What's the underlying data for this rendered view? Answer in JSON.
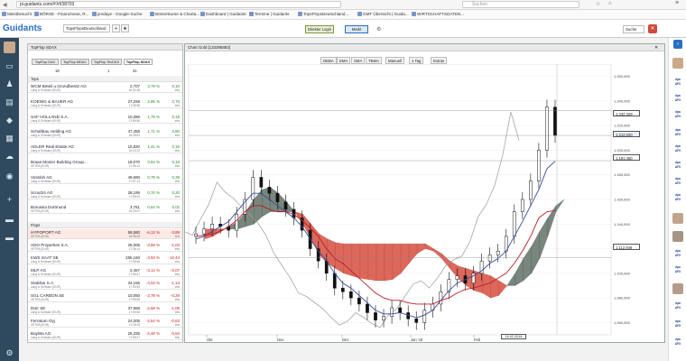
{
  "browser": {
    "url": "pi.guidants.com/#!/rf/38703",
    "search_placeholder": "Suchen"
  },
  "bookmarks": [
    "Meistbesucht",
    "BÖRSE - Finanznews, R...",
    "jendaye - Google-Suche",
    "Börsenkurse & Charta...",
    "Dashboard | Guidants",
    "Termine | Guidants",
    "TopsFlopsDeutschland...",
    "GMT Übersicht | Guida...",
    "WIRTSCHAFTSDATEN..."
  ],
  "header": {
    "logo": "Guidants",
    "layout_label": "TopsFlopsDeutschland",
    "demo_button": "Direkter Login",
    "market_button": "Markt",
    "search_label": "Suche"
  },
  "watchlist": {
    "title": "TopFlop SDAX",
    "tabs": [
      "TopFlop DAX",
      "TopFlop MDAX",
      "TopFlop TecDAX",
      "TopFlop SDAX"
    ],
    "counts": [
      "18",
      "1",
      "31"
    ],
    "tops_header": "Tops",
    "flops_header": "Flops",
    "tops": [
      {
        "name": "WCM Beteil.u.Grundbesitz AG",
        "exchange": "Lang & Schwarz (EUR)",
        "price": "2,707",
        "time": "16:32:28",
        "pct": "3,79 %",
        "abs": "0,10",
        "exch_short": "ebs"
      },
      {
        "name": "KOENIG & BAUER AG",
        "exchange": "Lang & Schwarz (EUR)",
        "price": "27,258",
        "time": "17:59:56",
        "pct": "2,85 %",
        "abs": "0,76",
        "exch_short": "ebs"
      },
      {
        "name": "SAF HOLLAND S.A.",
        "exchange": "Lang & Schwarz (EUR)",
        "price": "10,086",
        "time": "17:59:56",
        "pct": "1,79 %",
        "abs": "0,18",
        "exch_short": "ebs"
      },
      {
        "name": "Schaltbau Holding AG",
        "exchange": "Lang & Schwarz (EUR)",
        "price": "47,458",
        "time": "16:28:51",
        "pct": "1,71 %",
        "abs": "0,80",
        "exch_short": "ebs"
      },
      {
        "name": "ADLER Real Estate AG",
        "exchange": "Lang & Schwarz (EUR)",
        "price": "10,820",
        "time": "16:23:22",
        "pct": "1,41 %",
        "abs": "0,15",
        "exch_short": "ebs"
      },
      {
        "name": "Braas Monier Building Group...",
        "exchange": "XETRA (EUR)",
        "price": "18,070",
        "time": "17:35:14",
        "pct": "0,94 %",
        "abs": "0,18",
        "exch_short": "ebs"
      },
      {
        "name": "Vossloh AG",
        "exchange": "Lang & Schwarz (EUR)",
        "price": "49,590",
        "time": "17:57:14",
        "pct": "0,79 %",
        "abs": "0,39",
        "exch_short": "ebs"
      },
      {
        "name": "Scout24 AG",
        "exchange": "Lang & Schwarz (EUR)",
        "price": "28,195",
        "time": "17:59:53",
        "pct": "0,70 %",
        "abs": "0,20",
        "exch_short": "ebs"
      },
      {
        "name": "Borussia Dortmund",
        "exchange": "XETRA (EUR)",
        "price": "3,761",
        "time": "16:25:07",
        "pct": "0,64 %",
        "abs": "0,02",
        "exch_short": "ebs"
      }
    ],
    "flops": [
      {
        "name": "HYPOPORT AG",
        "exchange": "XETRA (EUR)",
        "price": "59,580",
        "time": "16:35:28",
        "pct": "-6,13 %",
        "abs": "-3,89",
        "exch_short": "ebs"
      },
      {
        "name": "ADO Properties S.A.",
        "exchange": "XETRA (EUR)",
        "price": "25,005",
        "time": "17:35:14",
        "pct": "-3,59 %",
        "abs": "-1,03",
        "exch_short": "ebs"
      },
      {
        "name": "KWS SAAT SE",
        "exchange": "Lang & Schwarz (EUR)",
        "price": "255,160",
        "time": "17:59:56",
        "pct": "-3,93 %",
        "abs": "-10,44",
        "exch_short": "ebs"
      },
      {
        "name": "MLP AG",
        "exchange": "Lang & Schwarz (EUR)",
        "price": "2,457",
        "time": "17:59:47",
        "pct": "-3,14 %",
        "abs": "-0,07",
        "exch_short": "ebs"
      },
      {
        "name": "Stabilus S.A.",
        "exchange": "Lang & Schwarz (EUR)",
        "price": "34,165",
        "time": "17:59:59",
        "pct": "-3,04 %",
        "abs": "-1,13",
        "exch_short": "ebs"
      },
      {
        "name": "SGL CARBON SE",
        "exchange": "XETRA (EUR)",
        "price": "10,050",
        "time": "17:59:59",
        "pct": "-2,79 %",
        "abs": "-0,29",
        "exch_short": "ebs"
      },
      {
        "name": "Dürr SE",
        "exchange": "Lang & Schwarz (EUR)",
        "price": "37,968",
        "time": "17:59:56",
        "pct": "-2,58 %",
        "abs": "-1,06",
        "exch_short": "ebs"
      },
      {
        "name": "Ferratum Oyj",
        "exchange": "XETRA (EUR)",
        "price": "24,005",
        "time": "17:25:29",
        "pct": "-2,54 %",
        "abs": "-0,63",
        "exch_short": "ebs"
      },
      {
        "name": "BayWa AG",
        "exchange": "Lang & Schwarz (EUR)",
        "price": "25,335",
        "time": "17:59:47",
        "pct": "-2,48 %",
        "abs": "-0,64",
        "exch_short": "ebs"
      }
    ]
  },
  "chart": {
    "title": "Chart Gold [133385883]",
    "toolbar": [
      "DEBA",
      "EMA",
      "SMA",
      "TEMA",
      "Manuell",
      "1 Tag",
      "Extras"
    ],
    "legend_line1": "Gold  O: 1.209,580  H: 1.216,300  L: 1.190,350  C: 1.214,650",
    "legend_line2": "90/65; 26; 52; 26) 1.107,080  1.201,190  1.092,925  1.084,369  1.214,650",
    "legend_line3": "21.09.2015 - 15.02.2016 (5 Monate, 1 Tag)",
    "current_price_tag": "1.212,020",
    "upper_price_tag": "1.232,329",
    "mid_price_tag": "1.191,450",
    "lower_price_tag": "1.112,949",
    "date_tag": "16.02.2016",
    "colors": {
      "cloud_bear": "#d9584a",
      "cloud_bull": "#6b7a70",
      "tenkan": "#3a4a9e",
      "kijun": "#b81c2a",
      "chikou": "#9a9a9a",
      "candle": "#111111",
      "accent": "#2b6fbf"
    }
  },
  "chart_data": {
    "type": "line",
    "title": "",
    "xlabel": "",
    "ylabel": "",
    "ylim": [
      1050,
      1270
    ],
    "x_ticks": [
      "Okt",
      "Nov",
      "Dez",
      "Jan '16",
      "Feb"
    ],
    "y_ticks": [
      "1.260,000",
      "1.240,000",
      "1.220,000",
      "1.200,000",
      "1.180,000",
      "1.160,000",
      "1.140,000",
      "1.120,000",
      "1.100,000",
      "1.080,000",
      "1.060,000"
    ],
    "series": [
      {
        "values": [
          1132,
          1136,
          1140,
          1138,
          1135,
          1148,
          1160,
          1178,
          1170,
          1165,
          1158,
          1152,
          1145,
          1135,
          1120,
          1110,
          1100,
          1088,
          1085,
          1080,
          1075,
          1068,
          1062,
          1065,
          1072,
          1068,
          1063,
          1060,
          1070,
          1075,
          1085,
          1095,
          1098,
          1092,
          1100,
          1110,
          1115,
          1118,
          1130,
          1150,
          1160,
          1175,
          1200,
          1235,
          1212
        ]
      },
      {
        "values": [
          1128,
          1130,
          1134,
          1138,
          1142,
          1150,
          1158,
          1165,
          1165,
          1160,
          1155,
          1150,
          1145,
          1138,
          1128,
          1118,
          1110,
          1100,
          1092,
          1088,
          1082,
          1076,
          1070,
          1067,
          1067,
          1068,
          1066,
          1064,
          1066,
          1070,
          1078,
          1086,
          1092,
          1095,
          1098,
          1102,
          1108,
          1112,
          1118,
          1130,
          1142,
          1155,
          1168,
          1185,
          1191
        ]
      },
      {
        "values": [
          1130,
          1131,
          1132,
          1134,
          1138,
          1143,
          1150,
          1155,
          1155,
          1152,
          1150,
          1150,
          1148,
          1143,
          1137,
          1130,
          1120,
          1112,
          1108,
          1102,
          1096,
          1090,
          1084,
          1080,
          1078,
          1078,
          1076,
          1075,
          1075,
          1075,
          1078,
          1080,
          1084,
          1087,
          1088,
          1090,
          1092,
          1096,
          1100,
          1108,
          1118,
          1130,
          1145,
          1150,
          1151
        ]
      }
    ]
  }
}
